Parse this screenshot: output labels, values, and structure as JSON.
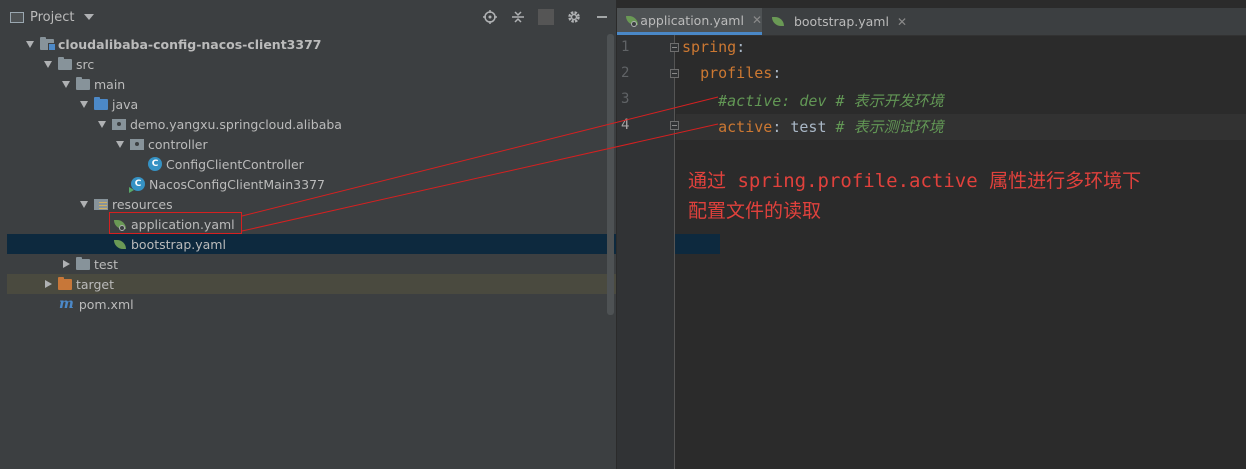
{
  "project_panel": {
    "title": "Project",
    "tools": [
      "crosshair-icon",
      "collapse-icon",
      "gear-icon",
      "minimize-icon"
    ],
    "tree": [
      {
        "label": "cloudalibaba-config-nacos-client3377",
        "icon": "module-folder-icon",
        "expanded": true
      },
      {
        "label": "src",
        "icon": "folder-icon",
        "expanded": true
      },
      {
        "label": "main",
        "icon": "folder-icon",
        "expanded": true
      },
      {
        "label": "java",
        "icon": "source-folder-icon",
        "expanded": true
      },
      {
        "label": "demo.yangxu.springcloud.alibaba",
        "icon": "package-icon",
        "expanded": true
      },
      {
        "label": "controller",
        "icon": "package-icon",
        "expanded": true
      },
      {
        "label": "ConfigClientController",
        "icon": "class-icon"
      },
      {
        "label": "NacosConfigClientMain3377",
        "icon": "main-class-icon"
      },
      {
        "label": "resources",
        "icon": "resources-folder-icon",
        "expanded": true
      },
      {
        "label": "application.yaml",
        "icon": "spring-config-icon"
      },
      {
        "label": "bootstrap.yaml",
        "icon": "spring-leaf-icon",
        "selected": true
      },
      {
        "label": "test",
        "icon": "folder-icon",
        "expanded": false
      },
      {
        "label": "target",
        "icon": "excluded-folder-icon",
        "expanded": false
      },
      {
        "label": "pom.xml",
        "icon": "maven-icon"
      }
    ]
  },
  "editor": {
    "tabs": [
      {
        "label": "application.yaml",
        "active": true
      },
      {
        "label": "bootstrap.yaml",
        "active": false
      }
    ],
    "line_numbers": [
      "1",
      "2",
      "3",
      "4"
    ],
    "current_line": 4,
    "lines": [
      {
        "key": "spring",
        "sep": ":"
      },
      {
        "key": "profiles",
        "sep": ":"
      },
      {
        "comment": "#active: dev # 表示开发环境"
      },
      {
        "key": "active",
        "sep": ": ",
        "value": "test ",
        "comment": "# 表示测试环境"
      }
    ]
  },
  "annotation": {
    "line1": "通过 spring.profile.active 属性进行多环境下",
    "line2": "配置文件的读取",
    "color": "#e0413c"
  },
  "colors": {
    "panel_bg": "#3c3f41",
    "editor_bg": "#2b2b2b",
    "selection": "#0d293e",
    "yaml_key": "#cc7832",
    "comment": "#629755",
    "highlight_box": "#d62020"
  }
}
